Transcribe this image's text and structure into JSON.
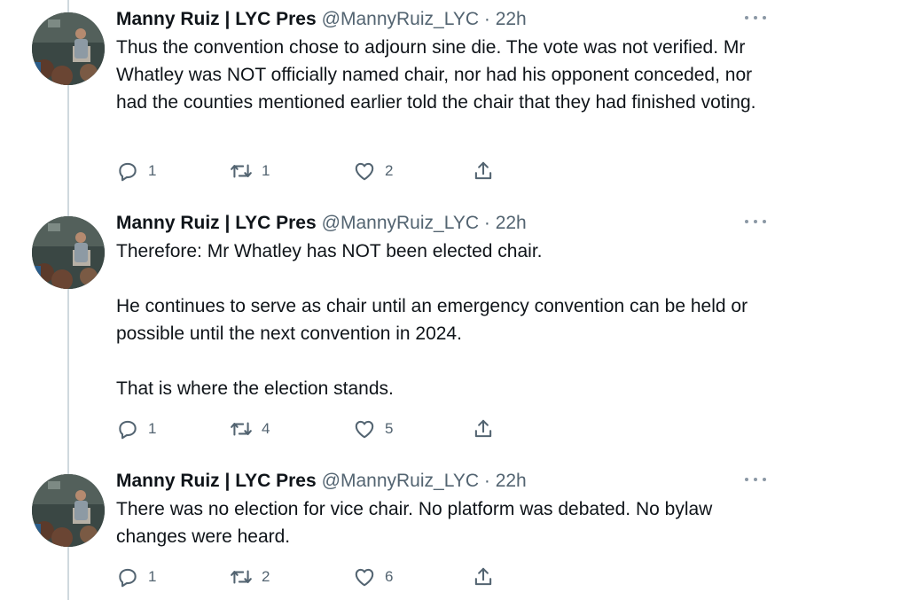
{
  "tweets": [
    {
      "name": "Manny Ruiz | LYC Pres",
      "handle": "@MannyRuiz_LYC",
      "separator": "·",
      "time": "22h",
      "paragraphs": [
        "Thus the convention chose to adjourn sine die. The vote was not verified. Mr Whatley was NOT officially named chair, nor had his opponent conceded, nor had the counties mentioned earlier told the chair that they had finished voting."
      ],
      "replies": "1",
      "retweets": "1",
      "likes": "2"
    },
    {
      "name": "Manny Ruiz | LYC Pres",
      "handle": "@MannyRuiz_LYC",
      "separator": "·",
      "time": "22h",
      "paragraphs": [
        "Therefore: Mr Whatley has NOT been elected chair.",
        "He continues to serve as chair until an emergency convention can be held or possible until the next convention in 2024.",
        "That is where the election stands."
      ],
      "replies": "1",
      "retweets": "4",
      "likes": "5"
    },
    {
      "name": "Manny Ruiz | LYC Pres",
      "handle": "@MannyRuiz_LYC",
      "separator": "·",
      "time": "22h",
      "paragraphs": [
        "There was no election for vice chair. No platform was debated. No bylaw changes were heard."
      ],
      "replies": "1",
      "retweets": "2",
      "likes": "6"
    }
  ],
  "icons": {
    "reply": "reply-icon",
    "retweet": "retweet-icon",
    "like": "heart-icon",
    "share": "share-icon",
    "more": "more-icon"
  },
  "colors": {
    "text": "#0f1419",
    "secondary": "#536471",
    "thread_line": "#cfd9de"
  }
}
